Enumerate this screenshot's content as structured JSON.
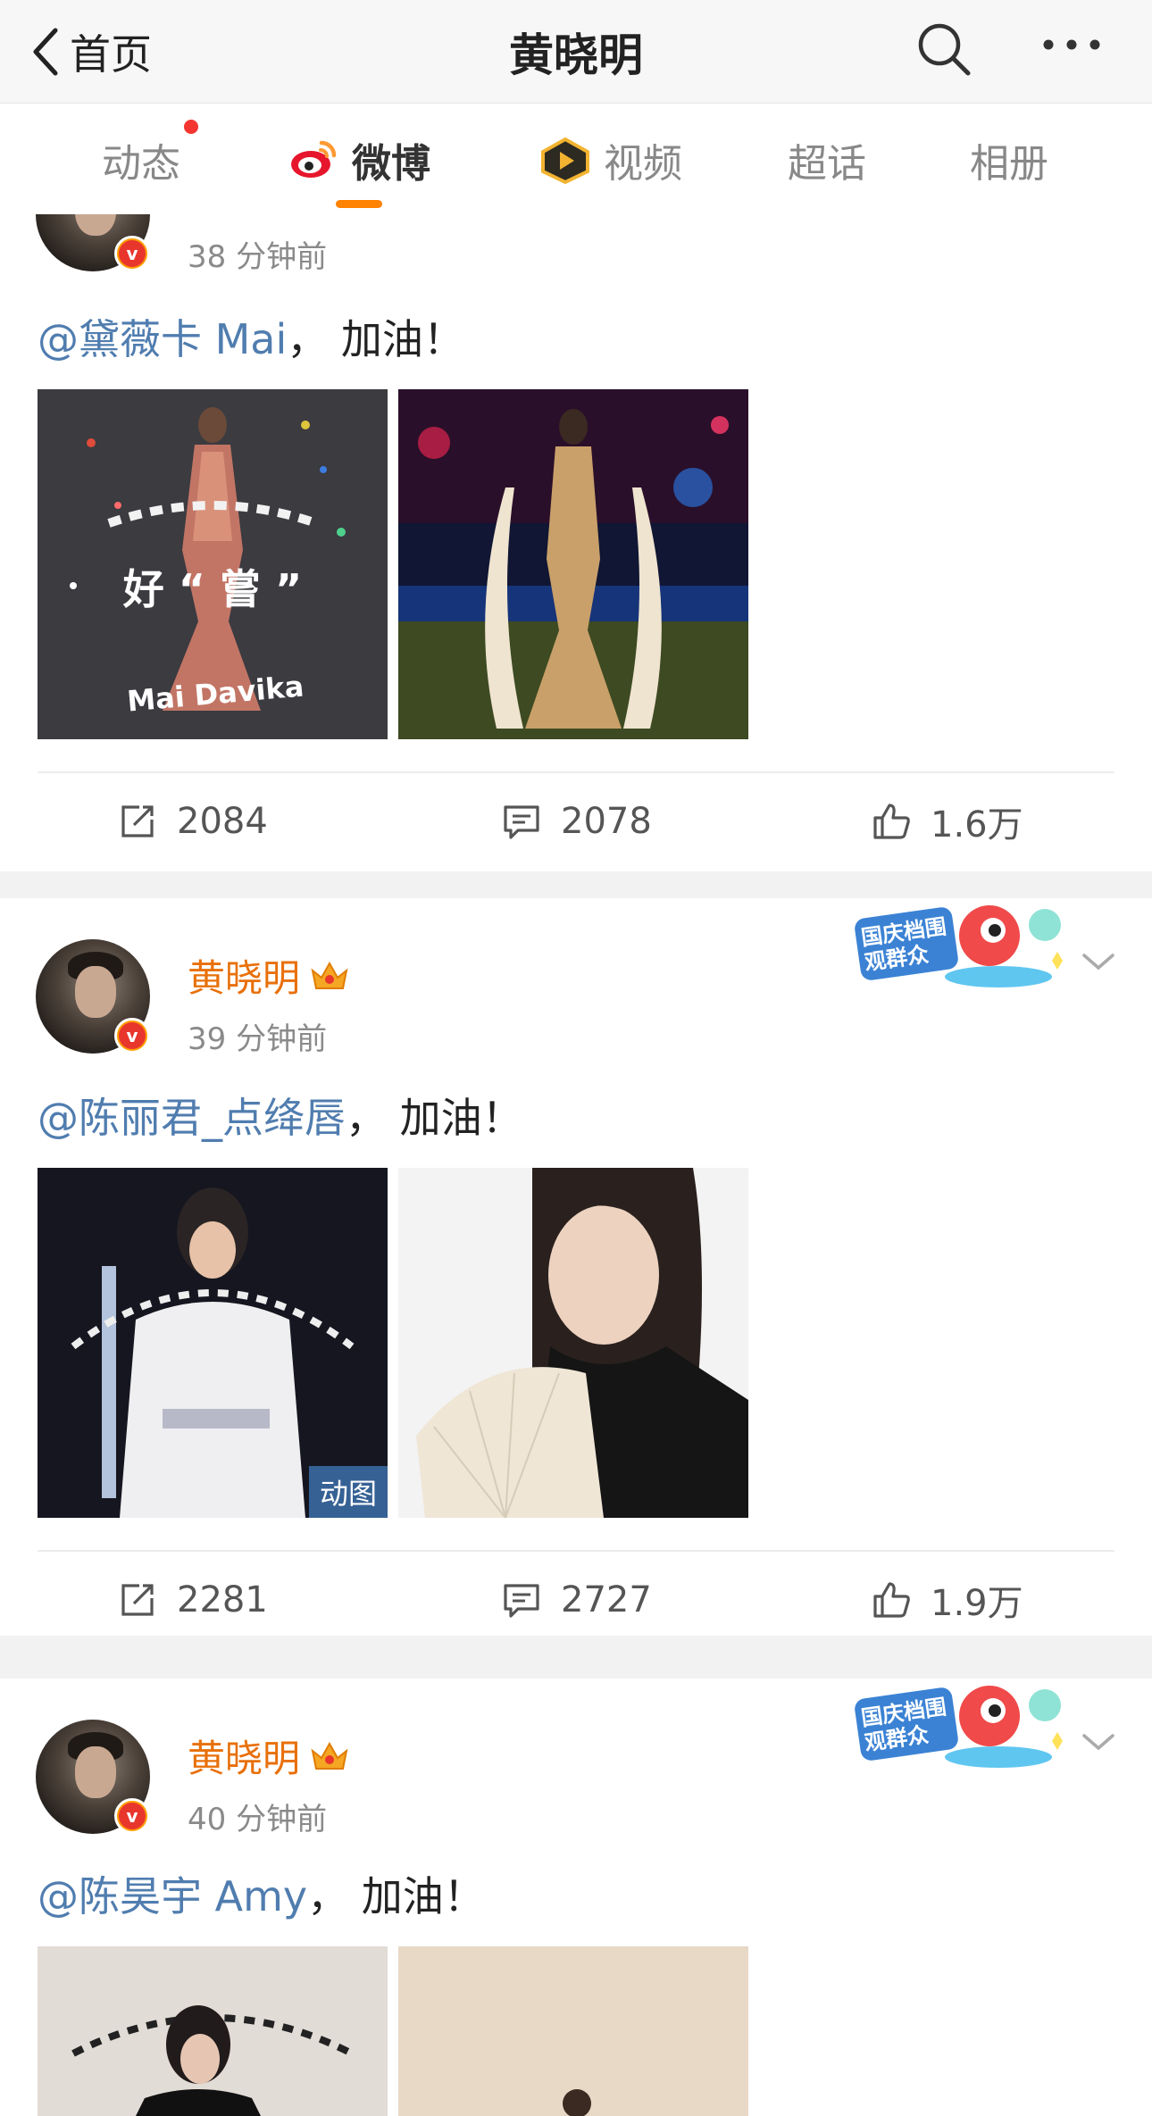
{
  "navbar": {
    "back_label": "首页",
    "title": "黄晓明"
  },
  "tabs": [
    {
      "label": "动态",
      "has_dot": true
    },
    {
      "label": "微博",
      "active": true
    },
    {
      "label": "视频"
    },
    {
      "label": "超话"
    },
    {
      "label": "相册"
    }
  ],
  "posts": [
    {
      "time": "38 分钟前",
      "mention": "@黛薇卡 Mai",
      "text_suffix": "， 加油！",
      "image1_caption": "Mai Davika",
      "repost": "2084",
      "comment": "2078",
      "like": "1.6万"
    },
    {
      "username": "黄晓明",
      "time": "39 分钟前",
      "mention": "@陈丽君_点绛唇",
      "text_suffix": "， 加油！",
      "image1_badge": "动图",
      "repost": "2281",
      "comment": "2727",
      "like": "1.9万",
      "promo": "国庆档围观群众"
    },
    {
      "username": "黄晓明",
      "time": "40 分钟前",
      "mention": "@陈昊宇 Amy",
      "text_suffix": "， 加油！",
      "promo": "国庆档围观群众"
    }
  ],
  "colors": {
    "accent_orange": "#ff8200",
    "username_orange": "#e8700a",
    "mention_blue": "#507daf",
    "notify_red": "#f43530"
  },
  "icons": [
    "back-chevron-icon",
    "search-icon",
    "more-icon",
    "weibo-logo-icon",
    "video-icon",
    "crown-icon",
    "repost-icon",
    "comment-icon",
    "like-icon",
    "chevron-down-icon"
  ]
}
